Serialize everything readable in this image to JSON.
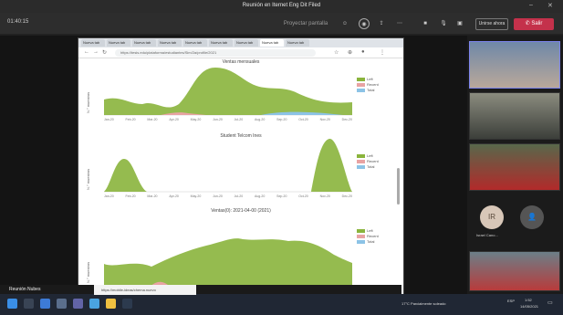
{
  "window": {
    "title": "Reunión en Iternet Eng Dit Filed"
  },
  "teams_bar": {
    "timer": "01:40:15",
    "share_label": "Proyectar pantalla",
    "join_label": "Unirse ahora",
    "leave_label": "Salir"
  },
  "browser": {
    "tabs": [
      "Nueva tab",
      "Nueva tab",
      "Nueva tab",
      "Nueva tab",
      "Nueva tab",
      "Nueva tab",
      "Nueva tab",
      "Nueva tab",
      "Nueva tab"
    ],
    "url": "https://tesis.edu/plataforma/estudiantes/Sim/2a/profile/2021",
    "charts": [
      {
        "title": "Ventas mensuales",
        "ylabel": "N.° muestras",
        "legend": [
          "Left",
          "Recent",
          "Total"
        ]
      },
      {
        "title": "Student Telcom Ines",
        "ylabel": "N.° muestras",
        "legend": [
          "Left",
          "Recent",
          "Total"
        ]
      },
      {
        "title": "Ventas(0): 2021-04-00 (2021)",
        "ylabel": "N.° muestras",
        "legend": [
          "Left",
          "Recent",
          "Total"
        ]
      }
    ],
    "x_ticks": [
      "Jan-20",
      "Feb-20",
      "Mar-20",
      "Apr-20",
      "May-20",
      "Jun-20",
      "Jul-20",
      "Aug-20",
      "Sep-20",
      "Oct-20",
      "Nov-20",
      "Dec-20"
    ]
  },
  "participants": [
    {
      "initials": "IR",
      "name": "Israel Cano..."
    },
    {
      "initials": "",
      "name": ""
    }
  ],
  "share_bar": {
    "sharer": "Reunión Nubes"
  },
  "taskbar": {
    "search_placeholder": "https://mobile-ideas/chema.nuevo",
    "weather": "17°C Parcialmente soleado",
    "time": "1:52",
    "date": "14/05/2021",
    "tray_label": "ESP"
  },
  "colors": {
    "series_green": "#8ab43c",
    "series_red": "#e8a3a3",
    "series_blue": "#8cc3e6",
    "leave_red": "#c4314b"
  }
}
